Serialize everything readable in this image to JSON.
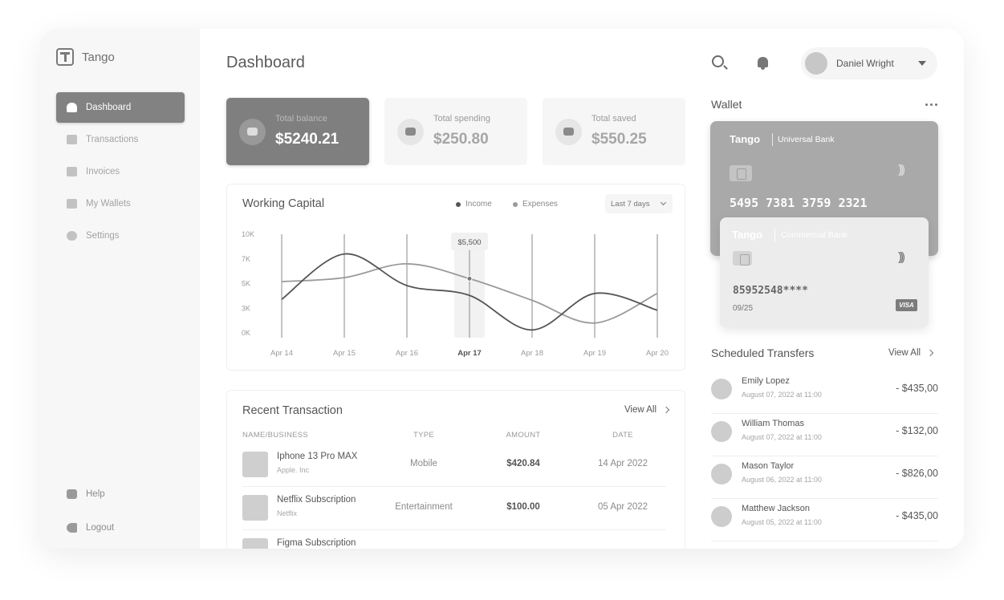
{
  "app": {
    "name": "Tango"
  },
  "sidebar": {
    "items": [
      {
        "label": "Dashboard",
        "icon": "home-icon"
      },
      {
        "label": "Transactions",
        "icon": "chart-icon"
      },
      {
        "label": "Invoices",
        "icon": "invoice-icon"
      },
      {
        "label": "My Wallets",
        "icon": "wallet-icon"
      },
      {
        "label": "Settings",
        "icon": "gear-icon"
      }
    ],
    "bottom": [
      {
        "label": "Help",
        "icon": "help-icon"
      },
      {
        "label": "Logout",
        "icon": "logout-icon"
      }
    ]
  },
  "header": {
    "title": "Dashboard",
    "user": {
      "name": "Daniel Wright"
    }
  },
  "stats": [
    {
      "label": "Total balance",
      "value": "$5240.21",
      "icon": "wallet-icon"
    },
    {
      "label": "Total spending",
      "value": "$250.80",
      "icon": "wallet-icon"
    },
    {
      "label": "Total saved",
      "value": "$550.25",
      "icon": "savings-icon"
    }
  ],
  "working_capital": {
    "title": "Working Capital",
    "legend": [
      "Income",
      "Expenses"
    ],
    "range": "Last 7 days",
    "tooltip": "$5,500"
  },
  "chart_data": {
    "type": "line",
    "title": "Working Capital",
    "x": [
      "Apr 14",
      "Apr 15",
      "Apr 16",
      "Apr 17",
      "Apr 18",
      "Apr 19",
      "Apr 20"
    ],
    "y_ticks": [
      "10K",
      "7K",
      "5K",
      "3K",
      "0K"
    ],
    "ylim": [
      0,
      10000
    ],
    "highlight": {
      "x": "Apr 17",
      "label": "$5,500"
    },
    "series": [
      {
        "name": "Income",
        "color": "#555555",
        "values": [
          3400,
          8000,
          4800,
          3800,
          300,
          4000,
          2300
        ]
      },
      {
        "name": "Expenses",
        "color": "#9a9a9a",
        "values": [
          5200,
          5600,
          7000,
          5500,
          3300,
          1000,
          4000
        ]
      }
    ],
    "grid": true,
    "legend_position": "top-right"
  },
  "recent_transactions": {
    "title": "Recent Transaction",
    "view_all": "View All",
    "columns": [
      "NAME/BUSINESS",
      "TYPE",
      "AMOUNT",
      "DATE"
    ],
    "rows": [
      {
        "name": "Iphone 13 Pro MAX",
        "business": "Apple. Inc",
        "type": "Mobile",
        "amount": "$420.84",
        "date": "14 Apr 2022"
      },
      {
        "name": "Netflix Subscription",
        "business": "Netflix",
        "type": "Entertainment",
        "amount": "$100.00",
        "date": "05 Apr 2022"
      },
      {
        "name": "Figma Subscription",
        "business": "",
        "type": "",
        "amount": "",
        "date": ""
      }
    ]
  },
  "wallet": {
    "title": "Wallet",
    "cards": [
      {
        "brand": "Tango",
        "bank": "Universal Bank",
        "number": "5495  7381  3759  2321",
        "color": "#a9a9a9"
      },
      {
        "brand": "Tango",
        "bank": "Commercial Bank",
        "number": "85952548****",
        "expiry": "09/25",
        "network": "VISA",
        "color": "#ececec"
      }
    ]
  },
  "scheduled_transfers": {
    "title": "Scheduled Transfers",
    "view_all": "View All",
    "items": [
      {
        "name": "Emily Lopez",
        "date": "August 07, 2022 at 11:00",
        "amount": "- $435,00"
      },
      {
        "name": "William Thomas",
        "date": "August 07, 2022 at 11:00",
        "amount": "- $132,00"
      },
      {
        "name": "Mason Taylor",
        "date": "August 06, 2022 at 11:00",
        "amount": "- $826,00"
      },
      {
        "name": "Matthew Jackson",
        "date": "August 05, 2022 at 11:00",
        "amount": "- $435,00"
      }
    ]
  }
}
